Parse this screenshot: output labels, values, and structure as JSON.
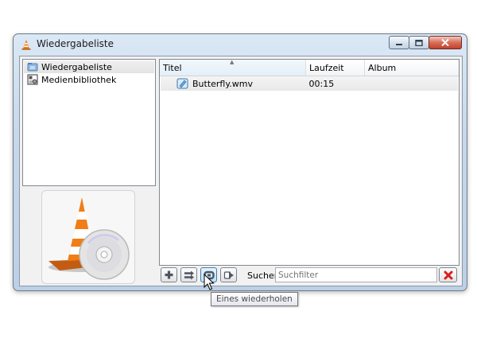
{
  "window": {
    "title": "Wiedergabeliste",
    "icon": "vlc-cone-icon",
    "caption_buttons": [
      "minimize-icon",
      "maximize-icon",
      "close-icon"
    ]
  },
  "sidebar": {
    "items": [
      {
        "label": "Wiedergabeliste",
        "icon": "folder-playlist-icon",
        "selected": true
      },
      {
        "label": "Medienbibliothek",
        "icon": "media-library-icon",
        "selected": false
      }
    ],
    "art": "vlc-cone-with-disc-image"
  },
  "playlist": {
    "columns": [
      "Titel",
      "Laufzeit",
      "Album"
    ],
    "sorted_column": "Titel",
    "rows": [
      {
        "title": "Butterfly.wmv",
        "duration": "00:15",
        "album": "",
        "icon": "video-file-icon"
      }
    ]
  },
  "toolbar": {
    "buttons": [
      "add-icon",
      "shuffle-icon",
      "repeat-one-icon",
      "random-icon"
    ],
    "active_button": "repeat-one-icon",
    "search_label": "Suchen",
    "search_placeholder": "Suchfilter",
    "clear_icon": "clear-red-x-icon"
  },
  "tooltip": {
    "text": "Eines wiederholen"
  },
  "colors": {
    "accent_blue": "#3c7fb1",
    "clear_red": "#d81e1e",
    "cone_orange": "#f07d15"
  }
}
